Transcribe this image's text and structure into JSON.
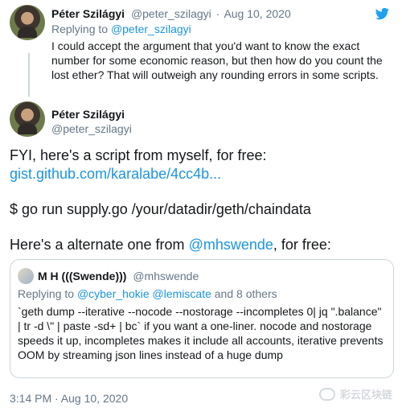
{
  "first_tweet": {
    "author_name": "Péter Szilágyi",
    "handle": "@peter_szilagyi",
    "separator": "·",
    "date": "Aug 10, 2020",
    "replying_prefix": "Replying to",
    "replying_to": "@peter_szilagyi",
    "body": "I could accept the argument that you'd want to know the exact number for some economic reason, but then how do you count the lost ether? That will outweigh any rounding errors in some scripts."
  },
  "main_tweet": {
    "author_name": "Péter Szilágyi",
    "handle": "@peter_szilagyi",
    "line1": "FYI, here's a script from myself, for free:",
    "link": "gist.github.com/karalabe/4cc4b...",
    "command": "$ go run supply.go /your/datadir/geth/chaindata",
    "line3_prefix": "Here's a alternate one from",
    "line3_mention": "@mhswende",
    "line3_suffix": ", for free:",
    "timestamp": "3:14 PM · Aug 10, 2020"
  },
  "quoted_tweet": {
    "author_name": "M H (((Swende)))",
    "handle": "@mhswende",
    "replying_prefix": "Replying to",
    "replying_to": "@cyber_hokie @lemiscate",
    "replying_suffix": "and 8 others",
    "body": "`geth dump --iterative --nocode --nostorage --incompletes 0| jq \".balance\" | tr -d \\\" | paste -sd+ | bc` if you want a one-liner. nocode and nostorage speeds it up, incompletes makes it include all accounts, iterative prevents OOM by streaming json lines instead of a huge dump"
  },
  "watermark": {
    "text": "彩云区块链"
  },
  "icons": {
    "twitter": "twitter-bird-icon",
    "watermark": "chat-bubble-icon"
  },
  "colors": {
    "link": "#1b95e0",
    "muted": "#657786",
    "text": "#14171a",
    "border": "#ccd6dd"
  }
}
